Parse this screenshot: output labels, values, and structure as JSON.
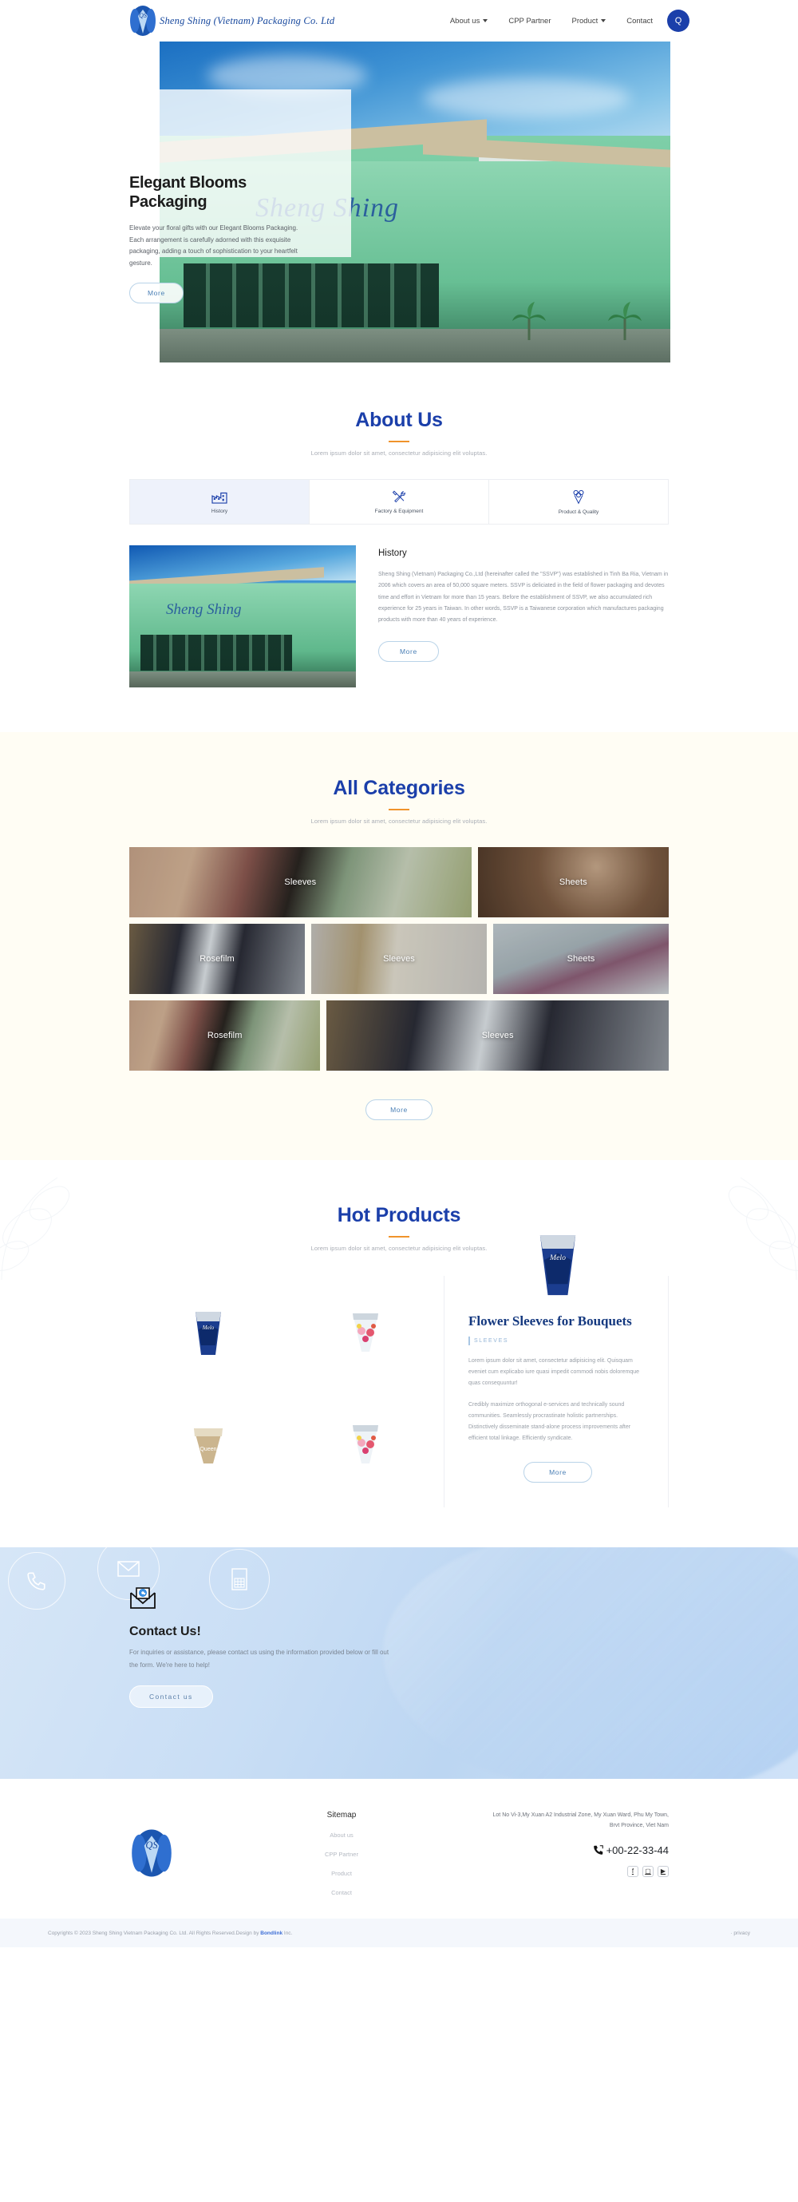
{
  "nav": {
    "brand_name": "Sheng Shing (Vietnam) Packaging Co. Ltd",
    "links": [
      {
        "label": "About us",
        "has_caret": true
      },
      {
        "label": "CPP Partner",
        "has_caret": false
      },
      {
        "label": "Product",
        "has_caret": true
      },
      {
        "label": "Contact",
        "has_caret": false
      }
    ],
    "search_icon": "search-icon",
    "search_glyph": "Q"
  },
  "hero": {
    "title_line1": "Elegant Blooms",
    "title_line2": "Packaging",
    "description": "Elevate your floral gifts with our Elegant Blooms Packaging. Each arrangement is carefully adorned with this exquisite packaging, adding a touch of sophistication to your heartfelt gesture.",
    "button": "More",
    "sign_text": "Sheng Shing"
  },
  "about": {
    "title": "About Us",
    "subtitle": "Lorem ipsum dolor sit amet, consectetur adipisicing elit voluptas.",
    "tabs": [
      {
        "label": "History",
        "icon": "factory-icon",
        "active": true
      },
      {
        "label": "Factory & Equipment",
        "icon": "tools-icon",
        "active": false
      },
      {
        "label": "Product & Quality",
        "icon": "bouquet-icon",
        "active": false
      }
    ],
    "panel_heading": "History",
    "panel_text": "Sheng Shing (Vietnam) Packaging Co.,Ltd (hereinafter called the \"SSVP\") was established in Tinh Ba Ria, Vietnam in 2006 which covers an area of 50,000 square meters. SSVP is deliciated in the field of flower packaging and devotes time and effort in Vietnam for more than 15 years. Before the establishment of SSVP, we also accumulated rich experience for 25 years in Taiwan. In other words, SSVP is a Taiwanese corporation which manufactures packaging products with more than 40 years of experience.",
    "button": "More",
    "photo_sign": "Sheng Shing"
  },
  "categories": {
    "title": "All Categories",
    "subtitle": "Lorem ipsum dolor sit amet, consectetur adipisicing elit voluptas.",
    "button": "More",
    "rows": [
      [
        {
          "label": "Sleeves",
          "flex": 197,
          "theme": "flowers-pastel"
        },
        {
          "label": "Sheets",
          "flex": 110,
          "theme": "brown-kraft"
        }
      ],
      [
        {
          "label": "Rosefilm",
          "flex": 100,
          "theme": "dark-stand"
        },
        {
          "label": "Sleeves",
          "flex": 100,
          "theme": "concrete-wrap"
        },
        {
          "label": "Sheets",
          "flex": 100,
          "theme": "grey-bouquet"
        }
      ],
      [
        {
          "label": "Rosefilm",
          "flex": 110,
          "theme": "flowers-pastel"
        },
        {
          "label": "Sleeves",
          "flex": 197,
          "theme": "dark-stand"
        }
      ]
    ]
  },
  "hot_products": {
    "title": "Hot Products",
    "subtitle": "Lorem ipsum dolor sit amet, consectetur adipisicing elit voluptas.",
    "thumbs": [
      {
        "name": "Melo sleeve",
        "theme": "melo-blue"
      },
      {
        "name": "Fruit sleeve",
        "theme": "fruit-clear"
      },
      {
        "name": "Queen sleeve",
        "theme": "queen-kraft"
      },
      {
        "name": "Fruit sleeve",
        "theme": "fruit-clear"
      }
    ],
    "detail": {
      "hero_theme": "melo-blue",
      "title": "Flower Sleeves for Bouquets",
      "tag": "SLEEVES",
      "paragraph_1": "Lorem ipsum dolor sit amet, consectetur adipisicing elit. Quisquam eveniet cum explicabo iure quasi impedit commodi nobis doloremque quas consequuntur!",
      "paragraph_2": "Credibly maximize orthogonal e-services and technically sound communities. Seamlessly procrastinate holistic partnerships. Distinctively disseminate stand-alone process improvements after efficient total linkage. Efficiently syndicate.",
      "button": "More"
    }
  },
  "contact": {
    "icon": "envelope-icon",
    "title": "Contact Us!",
    "description": "For inquiries or assistance, please contact us using the information provided below or fill out the form. We're here to help!",
    "button": "Contact us"
  },
  "footer": {
    "logo": "sheng-shing-logo",
    "sitemap_heading": "Sitemap",
    "sitemap_links": [
      "About us",
      "CPP Partner",
      "Product",
      "Contact"
    ],
    "address": "Lot No Vi-3,My Xuan A2 Industrial Zone, My Xuan Ward, Phu My Town, Brvt Province, Viet Nam",
    "phone": "+00-22-33-44",
    "phone_icon": "phone-icon",
    "socials": [
      {
        "name": "facebook-icon",
        "glyph": "f"
      },
      {
        "name": "instagram-icon",
        "glyph": "▢"
      },
      {
        "name": "youtube-icon",
        "glyph": "▶"
      }
    ],
    "copyright_prefix": "Copyrights © 2023 Sheng Shing Vietnam Packaging Co. Ltd. All Rights Reserved.Design by ",
    "copyright_link": "Bondlink",
    "copyright_suffix": " Inc.",
    "privacy": "· privacy"
  },
  "colors": {
    "brand_blue": "#1b3faa",
    "accent_orange": "#f0932b",
    "heading_blue": "#14387f",
    "cream_bg": "#fffdf4"
  }
}
